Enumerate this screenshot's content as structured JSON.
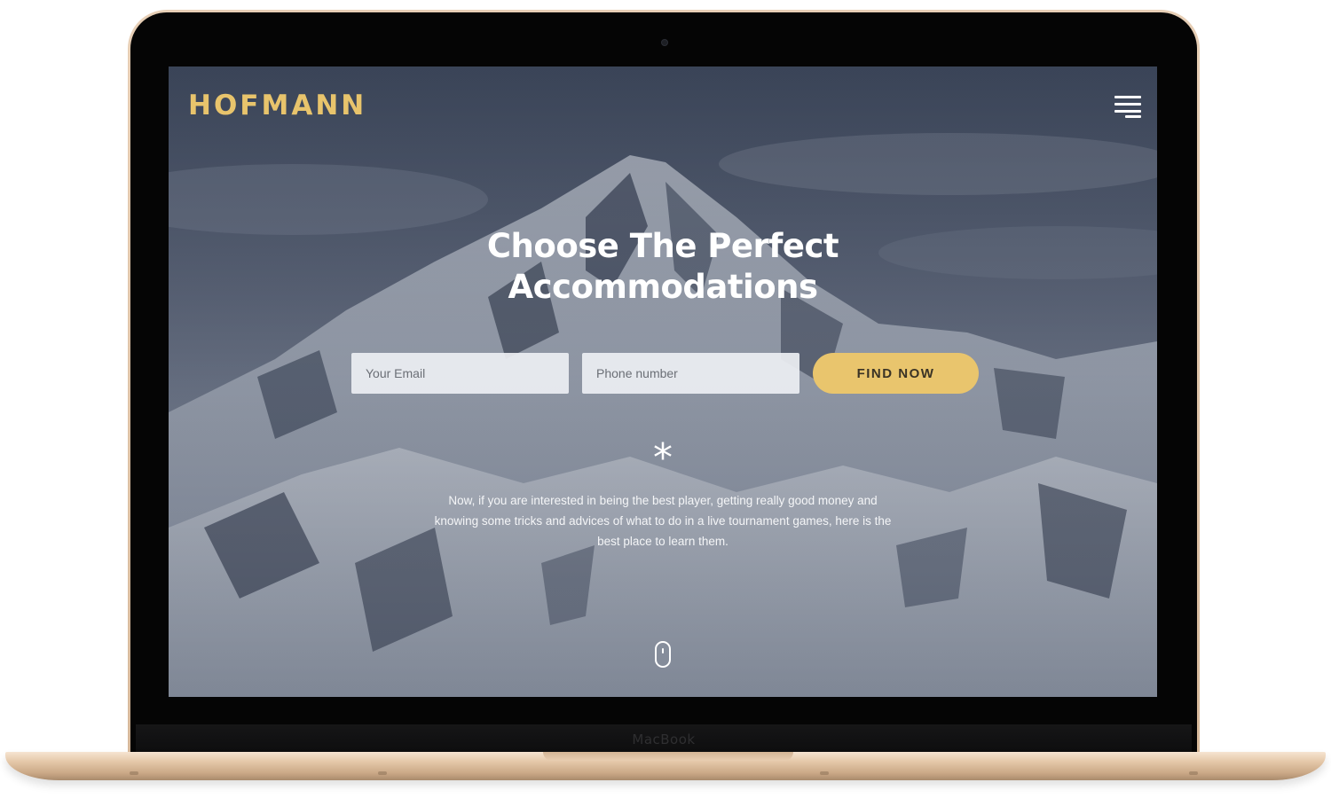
{
  "site": {
    "logo": "HOFMANN",
    "menu_icon": "hamburger-menu-icon",
    "accent_color": "#e8c46c"
  },
  "hero": {
    "title_line1": "Choose The Perfect",
    "title_line2": "Accommodations",
    "email_placeholder": "Your Email",
    "phone_placeholder": "Phone number",
    "find_button_label": "FIND NOW",
    "divider_symbol": "*",
    "description": "Now, if you are interested in being the best player, getting really good money and knowing some tricks and advices of what to do in a live tournament games, here is the best place to learn them.",
    "scroll_icon": "mouse-scroll-icon"
  },
  "device": {
    "brand_label": "MacBook"
  }
}
